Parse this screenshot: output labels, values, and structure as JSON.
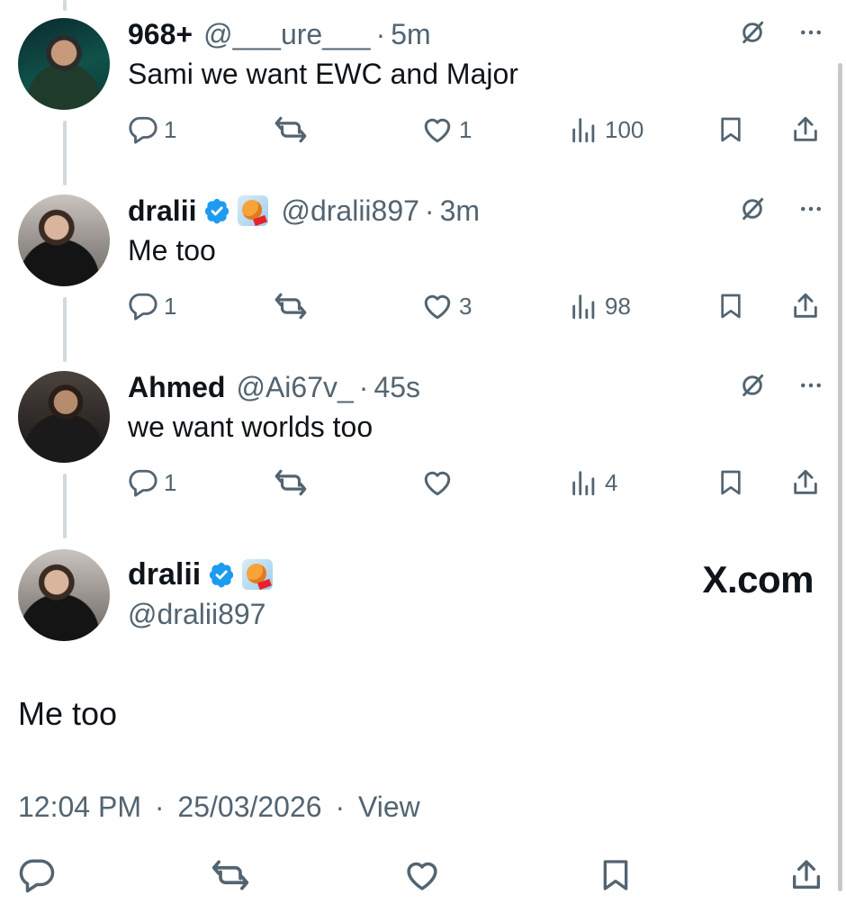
{
  "replies": [
    {
      "name": "968+",
      "handle": "@___ure___",
      "time": "5m",
      "text": "Sami we want EWC and Major",
      "verified": false,
      "replies": "1",
      "reposts": "",
      "likes": "1",
      "views": "100"
    },
    {
      "name": "dralii",
      "handle": "@dralii897",
      "time": "3m",
      "text": "Me too",
      "verified": true,
      "replies": "1",
      "reposts": "",
      "likes": "3",
      "views": "98"
    },
    {
      "name": "Ahmed",
      "handle": "@Ai67v_",
      "time": "45s",
      "text": "we want worlds too",
      "verified": false,
      "replies": "1",
      "reposts": "",
      "likes": "",
      "views": "4"
    }
  ],
  "separator": "·",
  "main_tweet": {
    "name": "dralii",
    "handle": "@dralii897",
    "watermark": "X.com",
    "text": "Me too",
    "timestamp": "12:04 PM",
    "date": "25/03/2026",
    "view_label": "View"
  },
  "icons": {
    "reply": "reply-icon",
    "repost": "repost-icon",
    "like": "heart-icon",
    "views": "analytics-icon",
    "bookmark": "bookmark-icon",
    "share": "share-icon",
    "grok": "grok-icon",
    "more": "more-icon",
    "verified": "verified-badge-icon"
  },
  "colors": {
    "text": "#0f1419",
    "secondary": "#536471",
    "verified": "#1d9bf0",
    "thread_line": "#cfd9de"
  }
}
